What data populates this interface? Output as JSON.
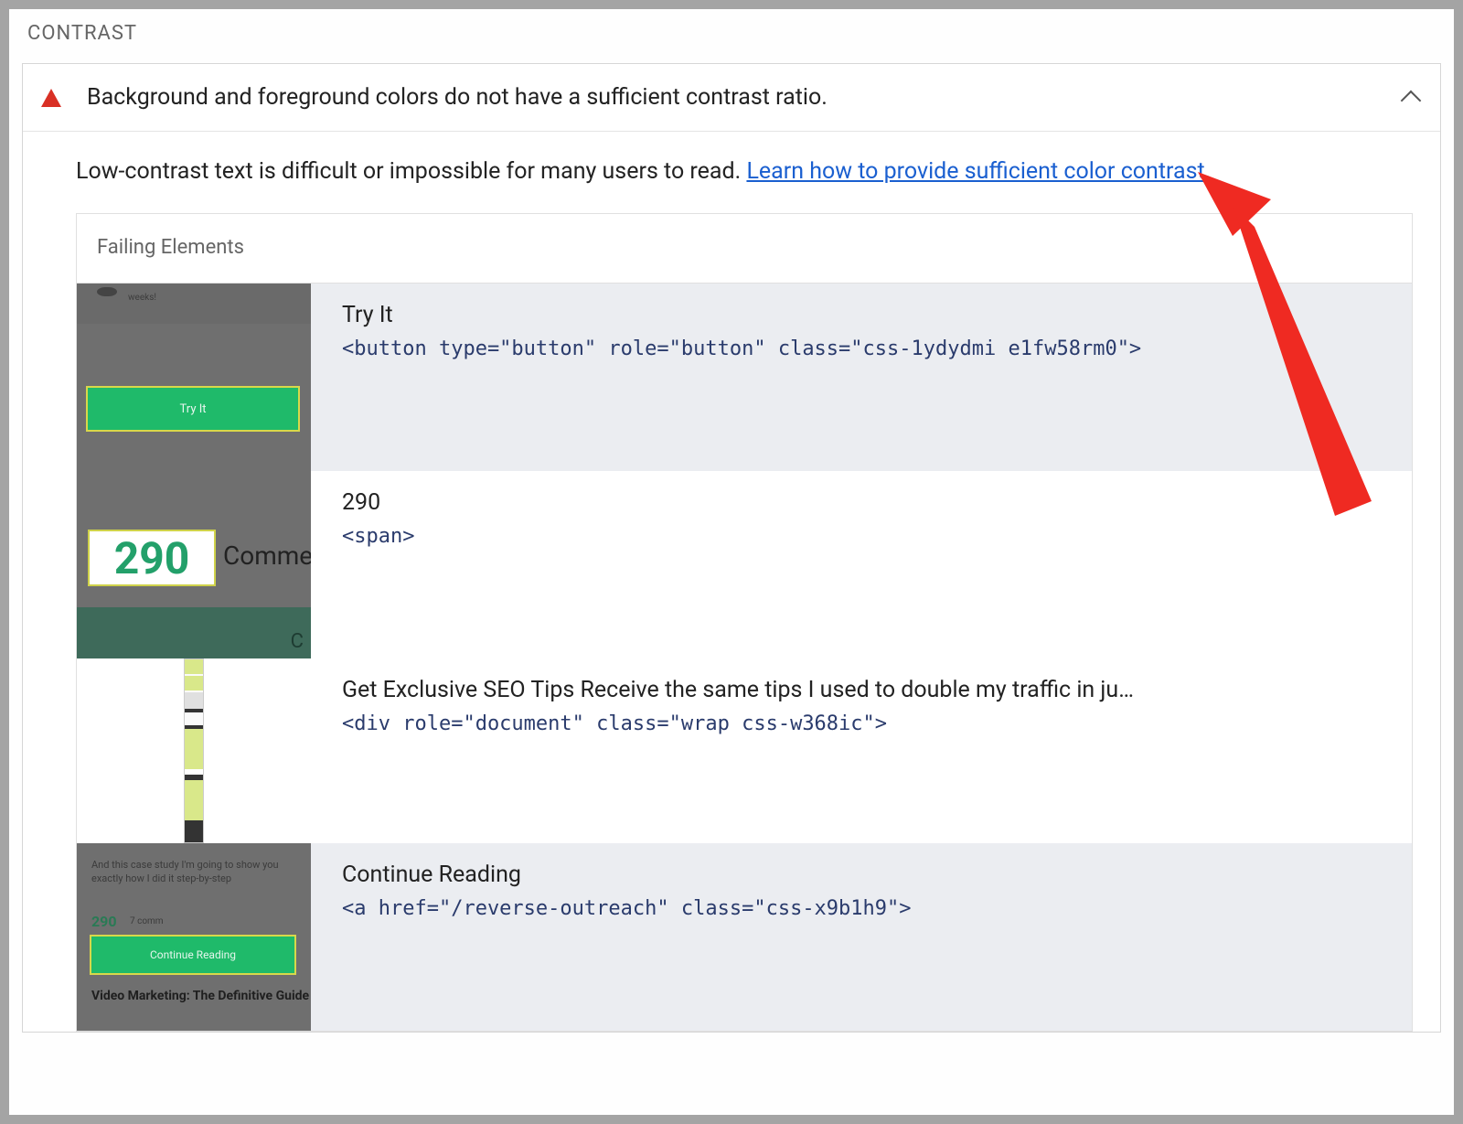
{
  "section": {
    "title": "CONTRAST"
  },
  "audit": {
    "title": "Background and foreground colors do not have a sufficient contrast ratio.",
    "description_prefix": "Low-contrast text is difficult or impossible for many users to read. ",
    "learn_link_text": "Learn how to provide sufficient color contrast",
    "period": "."
  },
  "failing": {
    "header": "Failing Elements",
    "items": [
      {
        "label": "Try It",
        "code": "<button type=\"button\" role=\"button\" class=\"css-1ydydmi e1fw58rm0\">",
        "thumb_btn": "Try It",
        "thumb_text1": "weeks!"
      },
      {
        "label": "290",
        "code": "<span>",
        "thumb_num": "290",
        "thumb_comm": "Comme",
        "thumb_cc": "C"
      },
      {
        "label": "Get Exclusive SEO Tips Receive the same tips I used to double my traffic in ju…",
        "code": "<div role=\"document\" class=\"wrap css-w368ic\">"
      },
      {
        "label": "Continue Reading",
        "code": "<a href=\"/reverse-outreach\" class=\"css-x9b1h9\">",
        "thumb_txt": "And this case study I'm going to show you exactly how I did it step-by-step",
        "thumb_290": "290",
        "thumb_cm": "7 comm",
        "thumb_btn": "Continue Reading",
        "thumb_foot": "Video Marketing: The Definitive Guide"
      }
    ]
  }
}
